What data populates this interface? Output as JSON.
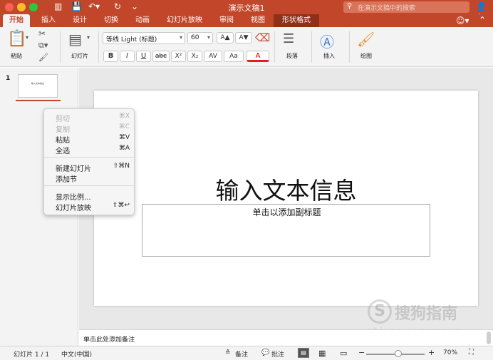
{
  "window": {
    "title": "演示文稿1"
  },
  "search": {
    "placeholder": "在演示文稿中的搜索"
  },
  "tabs": [
    {
      "label": "开始"
    },
    {
      "label": "插入"
    },
    {
      "label": "设计"
    },
    {
      "label": "切换"
    },
    {
      "label": "动画"
    },
    {
      "label": "幻灯片放映"
    },
    {
      "label": "审阅"
    },
    {
      "label": "视图"
    },
    {
      "label": "形状格式"
    }
  ],
  "ribbon": {
    "paste_label": "粘贴",
    "slides_label": "幻灯片",
    "font_name": "等线 Light (标题)",
    "font_size": "60",
    "bold": "B",
    "italic": "I",
    "underline": "U",
    "strike": "abc",
    "superscript": "X²",
    "subscript": "X₂",
    "spacing": "AV",
    "case": "Aa",
    "color": "A",
    "grow": "A▲",
    "shrink": "A▼",
    "paragraph_label": "段落",
    "insert_label": "插入",
    "draw_label": "绘图"
  },
  "thumbnail": {
    "number": "1",
    "preview_text": "输入文本信息"
  },
  "slide": {
    "title": "输入文本信息",
    "subtitle_placeholder": "单击以添加副标题"
  },
  "notes": {
    "placeholder": "单击此处添加备注"
  },
  "context_menu": [
    {
      "label": "剪切",
      "shortcut": "⌘X",
      "disabled": true
    },
    {
      "label": "复制",
      "shortcut": "⌘C",
      "disabled": true
    },
    {
      "label": "粘贴",
      "shortcut": "⌘V",
      "disabled": false
    },
    {
      "label": "全选",
      "shortcut": "⌘A",
      "disabled": false
    },
    {
      "label": "新建幻灯片",
      "shortcut": "⇧⌘N",
      "disabled": false
    },
    {
      "label": "添加节",
      "shortcut": "",
      "disabled": false
    },
    {
      "label": "显示比例...",
      "shortcut": "",
      "disabled": false
    },
    {
      "label": "幻灯片放映",
      "shortcut": "⇧⌘↩",
      "disabled": false
    }
  ],
  "status": {
    "slide_count": "幻灯片 1 / 1",
    "language": "中文(中国)",
    "notes": "备注",
    "comments": "批注",
    "zoom": "70%",
    "zoom_level": 0.55
  },
  "watermark": {
    "brand": "搜狗指南",
    "url": "zhinan.sogou.com"
  },
  "colors": {
    "accent": "#c2462a",
    "context_tab": "#8f3019"
  }
}
